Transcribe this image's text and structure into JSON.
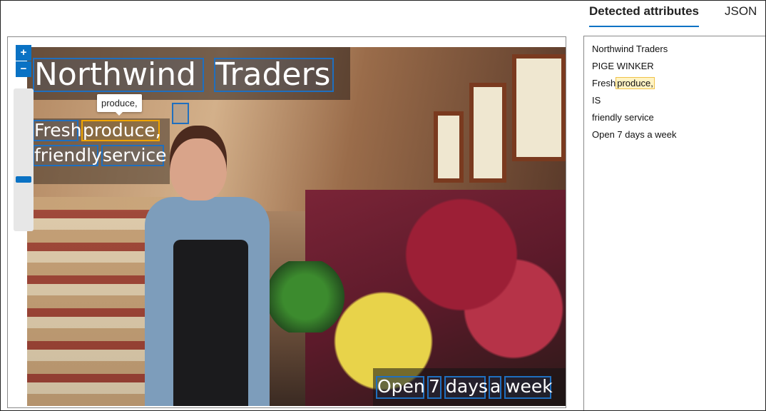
{
  "tabs": {
    "detected": "Detected attributes",
    "json": "JSON"
  },
  "viewer": {
    "zoom_in": "+",
    "zoom_out": "−",
    "zoom_level": 0.35,
    "tooltip": "produce,",
    "ocr_words": {
      "northwind": "Northwind",
      "traders": "Traders",
      "fresh": "Fresh",
      "produce": "produce,",
      "friendly": "friendly",
      "service": "service",
      "open": "Open",
      "seven": "7",
      "days": "days",
      "a": "a",
      "week": "week"
    }
  },
  "attributes": {
    "line1": "Northwind Traders",
    "line2": "PIGE WINKER",
    "line3_prefix": "Fresh",
    "line3_highlight": "produce,",
    "line4": "IS",
    "line5": "friendly service",
    "line6": "Open 7 days a week"
  },
  "colors": {
    "accent": "#0a72c4",
    "ocr_box": "#1f6fbf",
    "highlight": "#f0a500"
  }
}
